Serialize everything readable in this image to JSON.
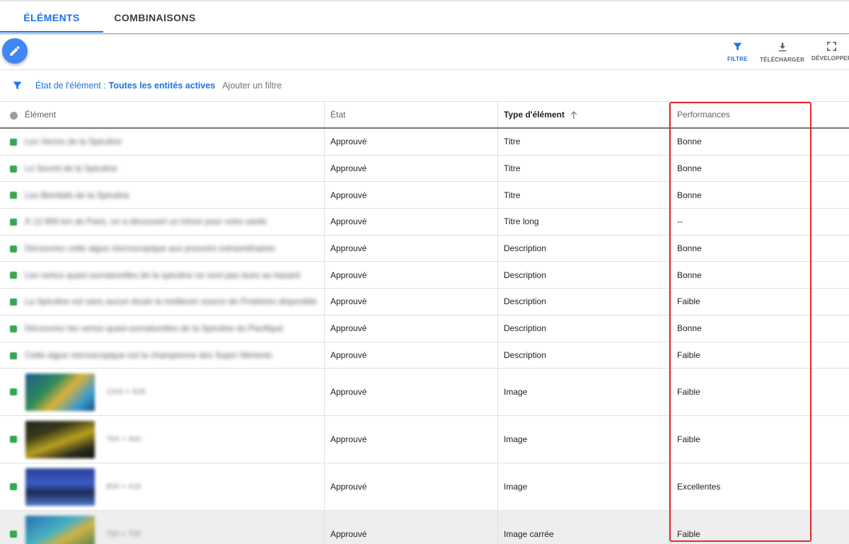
{
  "tabs": [
    {
      "label": "ÉLÉMENTS",
      "active": true
    },
    {
      "label": "COMBINAISONS",
      "active": false
    }
  ],
  "toolbar": {
    "edit_icon": "pencil-icon",
    "actions": [
      {
        "label": "FILTRE",
        "icon": "filter-icon"
      },
      {
        "label": "TÉLÉCHARGER",
        "icon": "download-icon"
      },
      {
        "label": "DÉVELOPPER",
        "icon": "fullscreen-icon"
      }
    ]
  },
  "filter": {
    "key": "État de l'élément :",
    "value": "Toutes les entités actives",
    "add_label": "Ajouter un filtre"
  },
  "table": {
    "headers": {
      "element": "Élément",
      "status": "État",
      "type": "Type d'élément",
      "performance": "Performances"
    },
    "rows": [
      {
        "element": "Les Verres de la Spiruline",
        "status": "Approuvé",
        "type": "Titre",
        "performance": "Bonne"
      },
      {
        "element": "Le Secret de la Spiruline",
        "status": "Approuvé",
        "type": "Titre",
        "performance": "Bonne"
      },
      {
        "element": "Les Bienfaits de la Spiruline",
        "status": "Approuvé",
        "type": "Titre",
        "performance": "Bonne"
      },
      {
        "element": "À 13 900 km de Paris, on a découvert un trésor pour votre santé",
        "status": "Approuvé",
        "type": "Titre long",
        "performance": "--"
      },
      {
        "element": "Découvrez cette algue microscopique aux pouvoirs extraordinaires",
        "status": "Approuvé",
        "type": "Description",
        "performance": "Bonne"
      },
      {
        "element": "Les vertus quasi-surnaturelles de la spiruline ne sont pas dues au hasard",
        "status": "Approuvé",
        "type": "Description",
        "performance": "Bonne"
      },
      {
        "element": "La Spiruline est sans aucun doute la meilleure source de Protéines disponible",
        "status": "Approuvé",
        "type": "Description",
        "performance": "Faible"
      },
      {
        "element": "Découvrez les vertus quasi-surnaturelles de la Spiruline du Pacifique",
        "status": "Approuvé",
        "type": "Description",
        "performance": "Bonne"
      },
      {
        "element": "Cette algue microscopique est la championne des Super Aliments",
        "status": "Approuvé",
        "type": "Description",
        "performance": "Faible"
      },
      {
        "element": "1200 × 628",
        "status": "Approuvé",
        "type": "Image",
        "performance": "Faible",
        "thumb": "linear-gradient(135deg,#1e5a8a 0%,#2f8a5a 35%,#d9b23a 55%,#3a9ad0 80%,#1b4f7a 100%)"
      },
      {
        "element": "764 × 400",
        "status": "Approuvé",
        "type": "Image",
        "performance": "Faible",
        "thumb": "linear-gradient(160deg,#222 0%,#3a3a1a 30%,#b9a020 55%,#2b2b1c 80%,#111 100%)"
      },
      {
        "element": "800 × 418",
        "status": "Approuvé",
        "type": "Image",
        "performance": "Excellentes",
        "thumb": "linear-gradient(180deg,#2a3f9a 0%,#3b5cc4 40%,#1c2a55 65%,#4f78c9 100%)"
      },
      {
        "element": "720 × 720",
        "status": "Approuvé",
        "type": "Image carrée",
        "performance": "Faible",
        "thumb": "linear-gradient(150deg,#2a6fb0 0%,#46b0c4 40%,#cfb247 60%,#2d7c4f 100%)"
      }
    ]
  },
  "colors": {
    "accent": "#1a73e8",
    "status_ok": "#34a853",
    "highlight": "#e0282e"
  }
}
